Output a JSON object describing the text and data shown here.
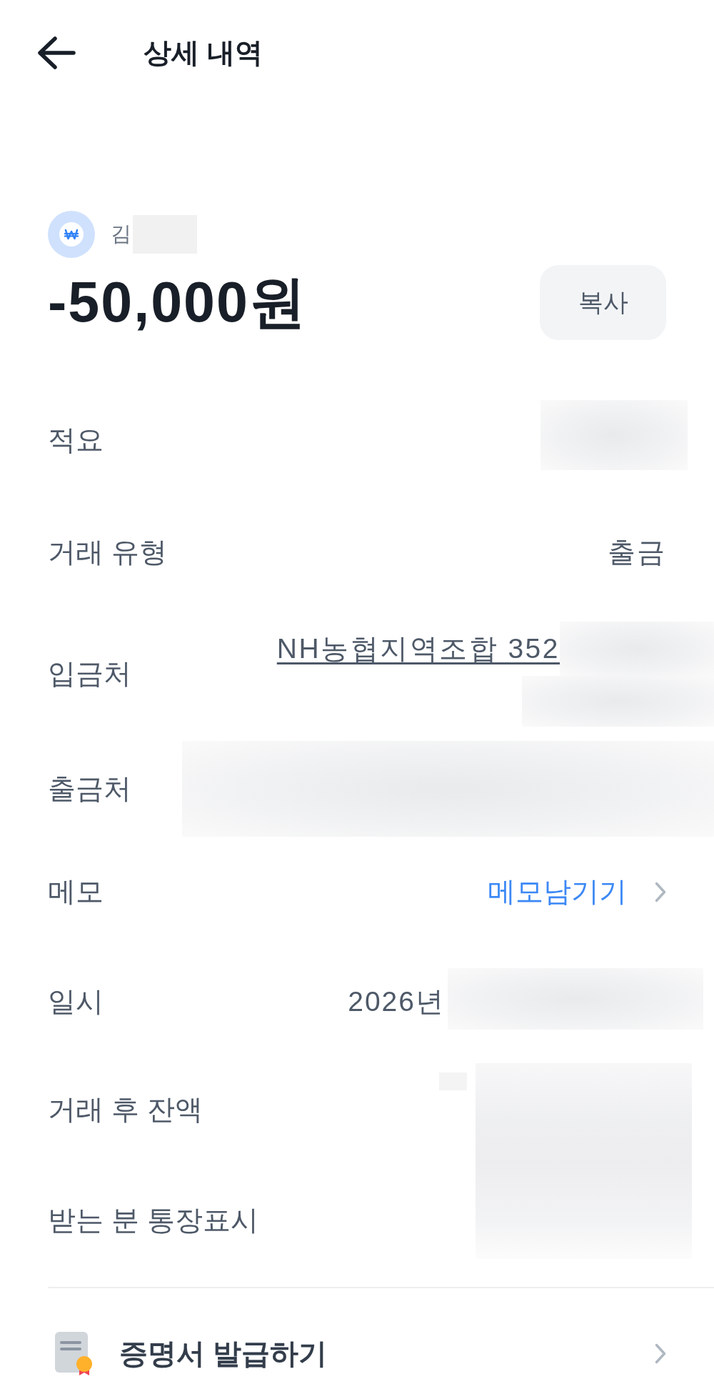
{
  "header": {
    "title": "상세 내역"
  },
  "summary": {
    "counterpart": "김",
    "counterpart_redacted": true,
    "amount": "-50,000원",
    "copy_button": "복사"
  },
  "details": [
    {
      "label": "적요",
      "redacted": true
    },
    {
      "label": "거래 유형",
      "value": {
        "kind": "plain",
        "text": "출금"
      }
    },
    {
      "label": "입금처",
      "value": {
        "kind": "link",
        "text": "NH농협지역조합 352"
      },
      "redacted": true
    },
    {
      "label": "출금처",
      "redacted": true
    },
    {
      "label": "메모",
      "value": {
        "kind": "action",
        "text": "메모남기기"
      }
    },
    {
      "label": "일시",
      "value": {
        "kind": "plain",
        "text": "2026년"
      },
      "redacted": true
    },
    {
      "label": "거래 후 잔액",
      "redacted": true
    },
    {
      "label": "받는 분 통장표시",
      "redacted": true
    }
  ],
  "certificate": {
    "label": "증명서 발급하기"
  }
}
